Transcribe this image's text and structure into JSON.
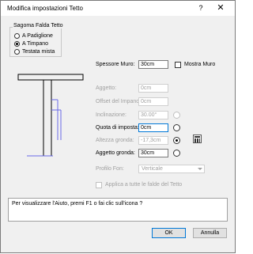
{
  "window": {
    "title": "Modifica impostazioni Tetto",
    "help": "?",
    "close": "✕"
  },
  "sagoma": {
    "label": "Sagoma Falda Tetto",
    "options": [
      {
        "label": "A Padiglione",
        "checked": false
      },
      {
        "label": "A Timpano",
        "checked": true
      },
      {
        "label": "Testata mista",
        "checked": false
      }
    ]
  },
  "spessore": {
    "label": "Spessore Muro:",
    "value": "30cm",
    "mostra_label": "Mostra Muro"
  },
  "fields": {
    "aggetto": {
      "label": "Aggetto:",
      "value": "0cm"
    },
    "offset": {
      "label": "Offset del Impano:",
      "value": "0cm"
    },
    "inclinazione": {
      "label": "Inclinazione:",
      "value": "30.00°"
    },
    "quota": {
      "label": "Quota di imposta:",
      "value": "0cm"
    },
    "altezza": {
      "label": "Altezza gronda:",
      "value": "-17,3cm"
    },
    "aggetto_gronda": {
      "label": "Aggetto gronda:",
      "value": "30cm"
    }
  },
  "profilo": {
    "label": "Profilo Fon:",
    "value": "Verticale"
  },
  "applica": {
    "label": "Applica a tutte le falde del Tetto"
  },
  "help_text": "Per visualizzare l'Aiuto, premi F1 o fai clic sull'icona ?",
  "buttons": {
    "ok": "OK",
    "cancel": "Annulla"
  },
  "colors": {
    "diagram_lines": "#000000",
    "guide_lines": "#6a6ae8"
  }
}
